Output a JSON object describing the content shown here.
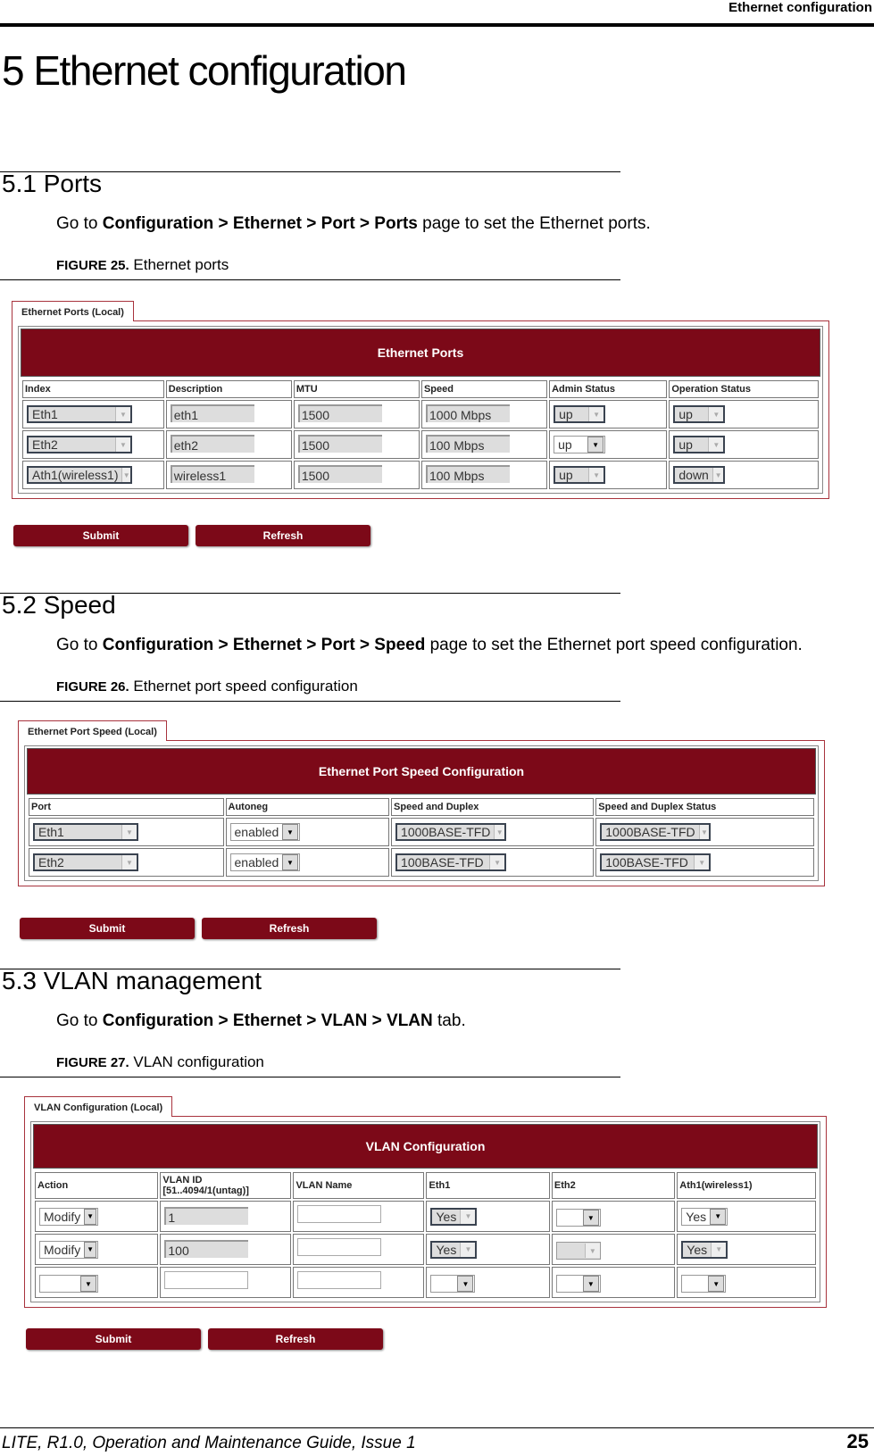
{
  "running_head": "Ethernet configuration",
  "chapter_title": "5 Ethernet configuration",
  "sections": [
    {
      "title": "5.1 Ports",
      "text_pre": "Go to ",
      "text_bold": "Configuration > Ethernet > Port > Ports",
      "text_post": " page to set the Ethernet ports.",
      "figure_label": "FIGURE 25.",
      "figure_caption": " Ethernet ports"
    },
    {
      "title": "5.2 Speed",
      "text_pre": "Go to ",
      "text_bold": "Configuration > Ethernet > Port > Speed",
      "text_post": " page to set the Ethernet port speed configuration.",
      "figure_label": "FIGURE 26.",
      "figure_caption": " Ethernet port speed configuration"
    },
    {
      "title": "5.3 VLAN management",
      "text_pre": "Go to ",
      "text_bold": "Configuration > Ethernet > VLAN > VLAN",
      "text_post": " tab.",
      "figure_label": "FIGURE 27.",
      "figure_caption": " VLAN configuration"
    }
  ],
  "ports_panel": {
    "tab": "Ethernet Ports (Local)",
    "banner": "Ethernet Ports",
    "headers": [
      "Index",
      "Description",
      "MTU",
      "Speed",
      "Admin Status",
      "Operation Status"
    ],
    "rows": [
      {
        "index": "Eth1",
        "description": "eth1",
        "mtu": "1500",
        "speed": "1000 Mbps",
        "admin": "up",
        "oper": "up"
      },
      {
        "index": "Eth2",
        "description": "eth2",
        "mtu": "1500",
        "speed": "100 Mbps",
        "admin": "up",
        "oper": "up"
      },
      {
        "index": "Ath1(wireless1)",
        "description": "wireless1",
        "mtu": "1500",
        "speed": "100 Mbps",
        "admin": "up",
        "oper": "down"
      }
    ],
    "submit": "Submit",
    "refresh": "Refresh"
  },
  "speed_panel": {
    "tab": "Ethernet Port Speed (Local)",
    "banner": "Ethernet Port Speed Configuration",
    "headers": [
      "Port",
      "Autoneg",
      "Speed and Duplex",
      "Speed and Duplex Status"
    ],
    "rows": [
      {
        "port": "Eth1",
        "autoneg": "enabled",
        "speed_duplex": "1000BASE-TFD",
        "status": "1000BASE-TFD"
      },
      {
        "port": "Eth2",
        "autoneg": "enabled",
        "speed_duplex": "100BASE-TFD",
        "status": "100BASE-TFD"
      }
    ],
    "submit": "Submit",
    "refresh": "Refresh"
  },
  "vlan_panel": {
    "tab": "VLAN Configuration (Local)",
    "banner": "VLAN Configuration",
    "headers": [
      "Action",
      "VLAN ID [51..4094/1(untag)]",
      "VLAN Name",
      "Eth1",
      "Eth2",
      "Ath1(wireless1)"
    ],
    "rows": [
      {
        "action": "Modify",
        "vlan_id": "1",
        "name": "",
        "eth1": "Yes",
        "eth2": "",
        "ath1": "Yes"
      },
      {
        "action": "Modify",
        "vlan_id": "100",
        "name": "",
        "eth1": "Yes",
        "eth2": "",
        "ath1": "Yes"
      },
      {
        "action": "",
        "vlan_id": "",
        "name": "",
        "eth1": "",
        "eth2": "",
        "ath1": ""
      }
    ],
    "submit": "Submit",
    "refresh": "Refresh"
  },
  "footer": {
    "left": "LITE, R1.0, Operation and Maintenance Guide, Issue 1",
    "page_number": "25"
  },
  "colors": {
    "brand_maroon": "#7c0918"
  }
}
